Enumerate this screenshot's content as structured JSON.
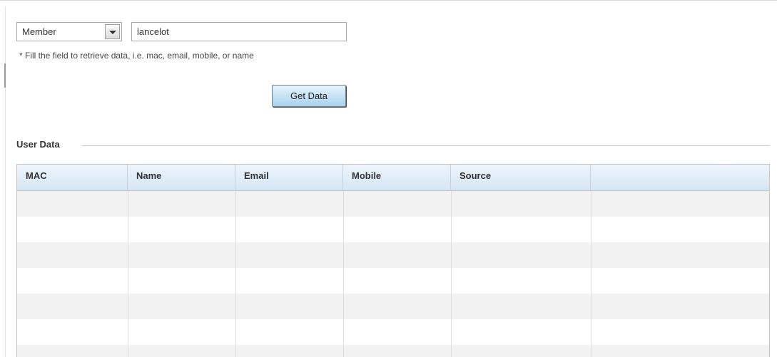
{
  "filter": {
    "type_select": {
      "value": "Member"
    },
    "search_value": "lancelot",
    "hint": "* Fill the field to retrieve data, i.e. mac, email, mobile, or name",
    "get_data_label": "Get Data"
  },
  "user_data": {
    "section_title": "User Data",
    "columns": [
      "MAC",
      "Name",
      "Email",
      "Mobile",
      "Source",
      ""
    ],
    "rows": []
  }
}
